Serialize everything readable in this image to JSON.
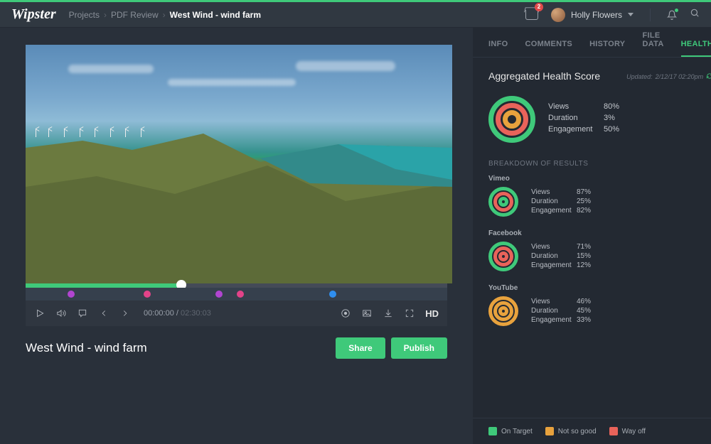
{
  "brand": "Wipster",
  "breadcrumb": {
    "root": "Projects",
    "middle": "PDF Review",
    "current": "West Wind - wind farm"
  },
  "header": {
    "inbox_badge": "2",
    "user_name": "Holly Flowers"
  },
  "video": {
    "title": "West Wind - wind farm",
    "current_time": "00:00:00",
    "total_time": "02:30:03",
    "hd_label": "HD",
    "share_label": "Share",
    "publish_label": "Publish"
  },
  "tabs": [
    "INFO",
    "COMMENTS",
    "HISTORY",
    "FILE DATA",
    "HEALTH"
  ],
  "active_tab": 4,
  "health": {
    "heading": "Aggregated Health Score",
    "updated_prefix": "Updated:",
    "updated_value": "2/12/17  02:20pm",
    "aggregate": {
      "views_label": "Views",
      "views_val": "80%",
      "duration_label": "Duration",
      "duration_val": "3%",
      "engagement_label": "Engagement",
      "engagement_val": "50%"
    },
    "breakdown_label": "BREAKDOWN OF RESULTS",
    "platforms": [
      {
        "name": "Vimeo",
        "colors": {
          "outer": "#3fc97a",
          "mid": "#e9635a",
          "inner": "#3fc97a"
        },
        "metrics": {
          "views": "87%",
          "duration": "25%",
          "engagement": "82%"
        }
      },
      {
        "name": "Facebook",
        "colors": {
          "outer": "#3fc97a",
          "mid": "#e9635a",
          "inner": "#e9635a"
        },
        "metrics": {
          "views": "71%",
          "duration": "15%",
          "engagement": "12%"
        }
      },
      {
        "name": "YouTube",
        "colors": {
          "outer": "#e8a23d",
          "mid": "#e8a23d",
          "inner": "#e8a23d"
        },
        "metrics": {
          "views": "46%",
          "duration": "45%",
          "engagement": "33%"
        }
      }
    ],
    "metric_labels": {
      "views": "Views",
      "duration": "Duration",
      "engagement": "Engagement"
    },
    "legend": [
      {
        "label": "On Target",
        "color": "#3fc97a"
      },
      {
        "label": "Not so good",
        "color": "#e8a23d"
      },
      {
        "label": "Way off",
        "color": "#e9635a"
      }
    ]
  },
  "colors": {
    "green": "#3fc97a",
    "orange": "#e8a23d",
    "red": "#e9635a"
  },
  "markers": [
    {
      "color": "#b145d1",
      "pos": 10
    },
    {
      "color": "#e24389",
      "pos": 28
    },
    {
      "color": "#b145d1",
      "pos": 45
    },
    {
      "color": "#e24389",
      "pos": 50
    },
    {
      "color": "#2f8ff0",
      "pos": 72
    }
  ]
}
